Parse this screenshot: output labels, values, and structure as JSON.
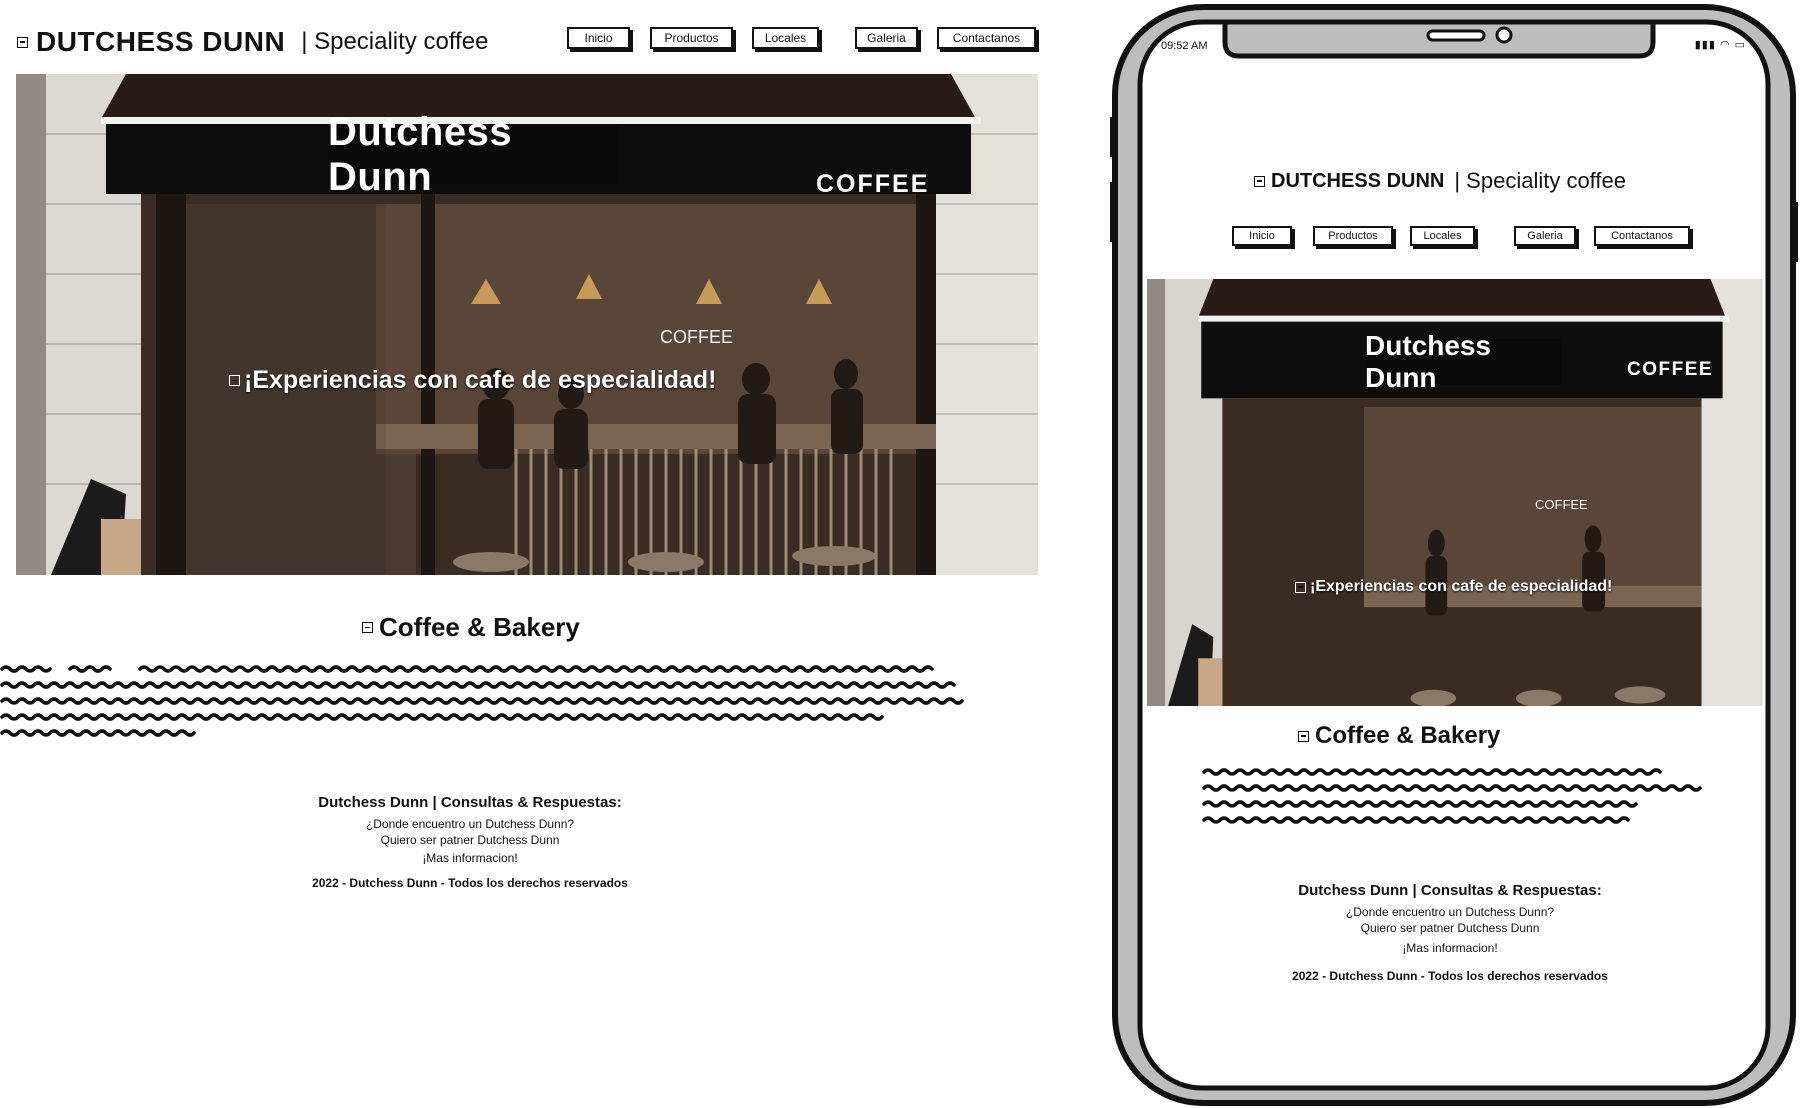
{
  "brand": {
    "name": "DUTCHESS DUNN",
    "tagline": "| Speciality coffee"
  },
  "nav": [
    {
      "label": "Inicio"
    },
    {
      "label": "Productos"
    },
    {
      "label": "Locales"
    },
    {
      "label": "Galeria"
    },
    {
      "label": "Contactanos"
    }
  ],
  "hero": {
    "sign": "Dutchess Dunn",
    "sign_small": "COFFEE",
    "window_text": "COFFEE",
    "headline": "¡Experiencias con cafe de especialidad!"
  },
  "section": {
    "title": "Coffee & Bakery"
  },
  "faq": {
    "title": "Dutchess Dunn | Consultas & Respuestas:",
    "items": [
      "¿Donde encuentro un Dutchess Dunn?",
      "Quiero ser patner Dutchess Dunn",
      "¡Mas informacion!"
    ]
  },
  "footer": {
    "copyright": "2022 - Dutchess Dunn - Todos los derechos reservados"
  },
  "phone": {
    "time": "09:52 AM",
    "status_icons": "signal-icon wifi-icon battery-icon"
  },
  "colors": {
    "ink": "#111111",
    "awning": "#1a1212",
    "wall": "#e6e3de",
    "interior": "#3a2c22"
  }
}
